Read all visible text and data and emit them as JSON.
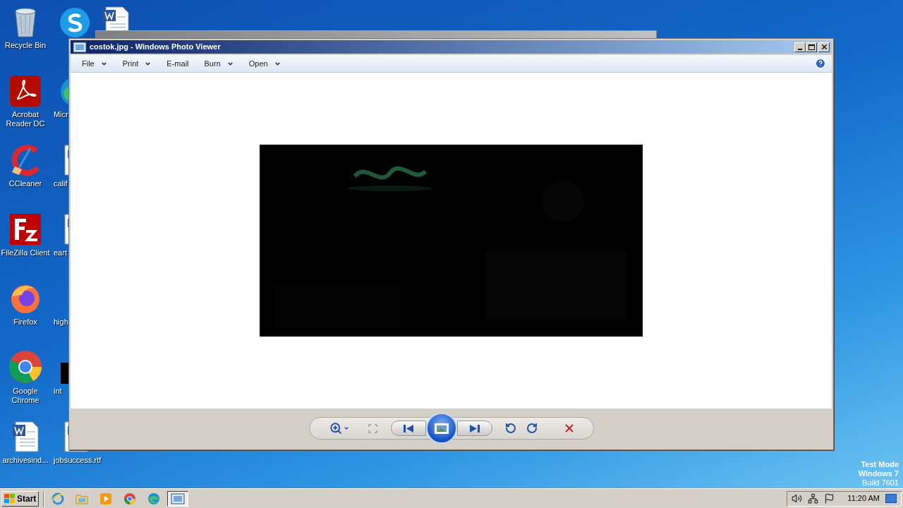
{
  "desktop_icons": [
    {
      "label": "Recycle Bin",
      "kind": "recycle"
    },
    {
      "label": "Acrobat Reader DC",
      "kind": "acrobat"
    },
    {
      "label": "CCleaner",
      "kind": "ccleaner"
    },
    {
      "label": "FileZilla Client",
      "kind": "filezilla"
    },
    {
      "label": "Firefox",
      "kind": "firefox"
    },
    {
      "label": "Google Chrome",
      "kind": "chrome"
    },
    {
      "label": "archivesind...",
      "kind": "word"
    }
  ],
  "desktop_icons_column_2": [
    {
      "kind": "skype"
    },
    {
      "label": "Micr",
      "kind": "edge"
    },
    {
      "label": "calif",
      "kind": "doc"
    },
    {
      "label": "eart",
      "kind": "doc"
    },
    {
      "label": "high",
      "kind": "blank"
    },
    {
      "label": "int",
      "kind": "black"
    },
    {
      "label": "jobsuccess.rtf",
      "kind": "doc"
    }
  ],
  "desktop_icons_column_3": [
    {
      "kind": "word"
    }
  ],
  "window": {
    "title": "costok.jpg - Windows Photo Viewer",
    "menu": [
      {
        "label": "File",
        "dropdown": true
      },
      {
        "label": "Print",
        "dropdown": true
      },
      {
        "label": "E-mail",
        "dropdown": false
      },
      {
        "label": "Burn",
        "dropdown": true
      },
      {
        "label": "Open",
        "dropdown": true
      }
    ]
  },
  "watermark_text": [
    "Test Mode",
    "Windows 7",
    "Build 7601"
  ],
  "taskbar": {
    "start": "Start",
    "items": [
      {
        "kind": "ie",
        "selected": false
      },
      {
        "kind": "explorer",
        "selected": false
      },
      {
        "kind": "media",
        "selected": false
      },
      {
        "kind": "chrome",
        "selected": false
      },
      {
        "kind": "edge",
        "selected": false
      },
      {
        "kind": "photoviewer",
        "selected": true
      }
    ],
    "clock": "11:20 AM"
  }
}
